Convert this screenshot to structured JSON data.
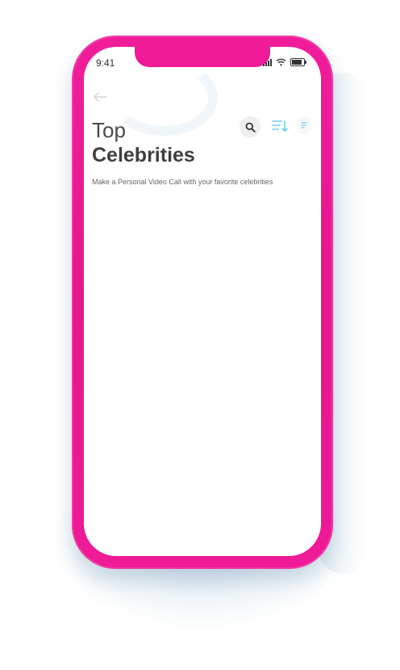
{
  "status_bar": {
    "time": "9:41"
  },
  "header": {
    "title_line1": "Top",
    "title_line2": "Celebrities",
    "subtitle": "Make a Personal Video Call with your favorite celebrities"
  },
  "icons": {
    "back": "arrow-left-icon",
    "search": "search-icon",
    "sort": "sort-icon",
    "filter": "filter-icon"
  },
  "colors": {
    "frame": "#ee1a97",
    "accent": "#4fc3f7",
    "text_dark": "#3f3f3f"
  }
}
